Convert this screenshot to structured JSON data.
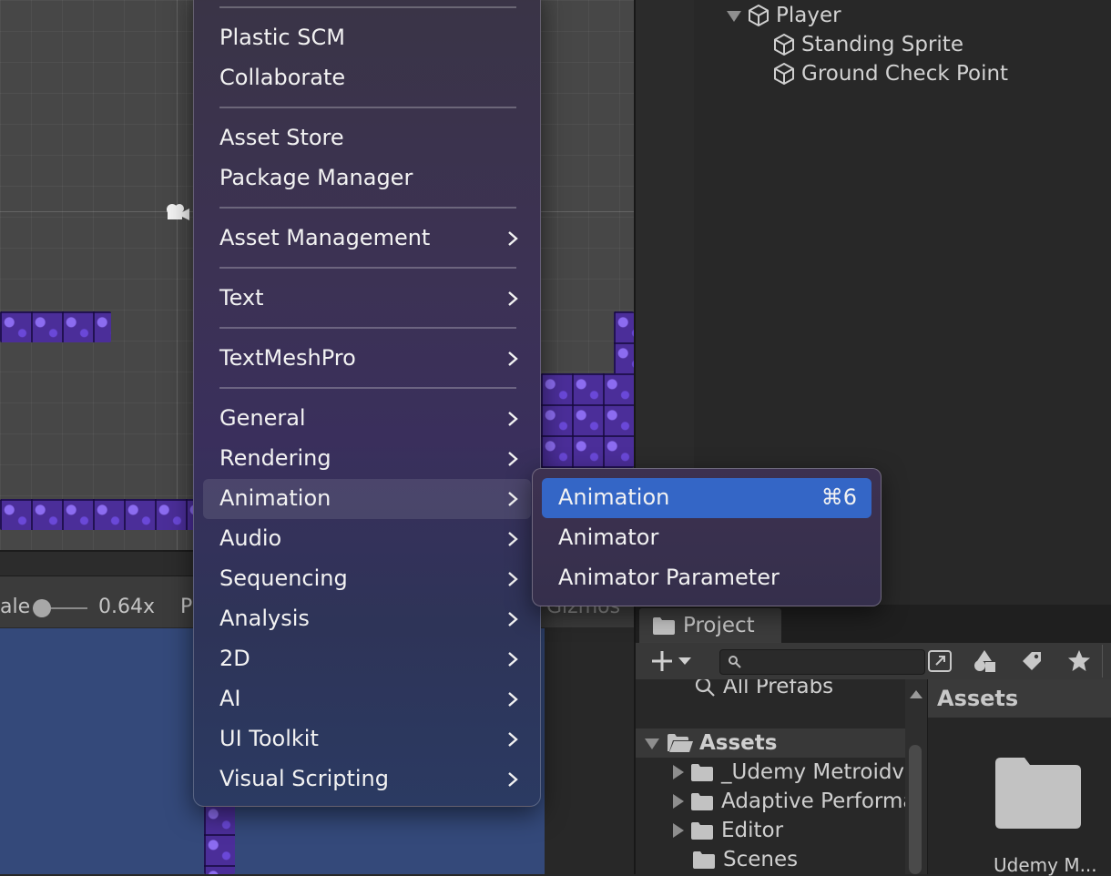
{
  "scene": {
    "toolbar": {
      "scale_label": "ale",
      "scale_value": "0.64x",
      "play_partial": "P",
      "gizmos_label": "Gizmos"
    }
  },
  "hierarchy": {
    "items": [
      {
        "label": "Player"
      },
      {
        "label": "Standing Sprite"
      },
      {
        "label": "Ground Check Point"
      }
    ]
  },
  "project": {
    "tab_label": "Project",
    "search_placeholder": "",
    "tree": {
      "favorites_item": "All Prefabs",
      "root": "Assets",
      "folders": [
        "_Udemy Metroidv",
        "Adaptive Performa",
        "Editor",
        "Scenes"
      ]
    },
    "assets_header": "Assets",
    "asset_item": "Udemy M..."
  },
  "main_menu": {
    "items": [
      {
        "label": "Plastic SCM"
      },
      {
        "label": "Collaborate"
      },
      {
        "label": "Asset Store"
      },
      {
        "label": "Package Manager"
      },
      {
        "label": "Asset Management"
      },
      {
        "label": "Text"
      },
      {
        "label": "TextMeshPro"
      },
      {
        "label": "General"
      },
      {
        "label": "Rendering"
      },
      {
        "label": "Animation"
      },
      {
        "label": "Audio"
      },
      {
        "label": "Sequencing"
      },
      {
        "label": "Analysis"
      },
      {
        "label": "2D"
      },
      {
        "label": "AI"
      },
      {
        "label": "UI Toolkit"
      },
      {
        "label": "Visual Scripting"
      }
    ]
  },
  "animation_submenu": {
    "items": [
      {
        "label": "Animation",
        "shortcut": "⌘6"
      },
      {
        "label": "Animator"
      },
      {
        "label": "Animator Parameter"
      }
    ]
  },
  "colors": {
    "selection": "#3466c6",
    "tile": "#4b2e99",
    "game_view": "#34497a"
  }
}
